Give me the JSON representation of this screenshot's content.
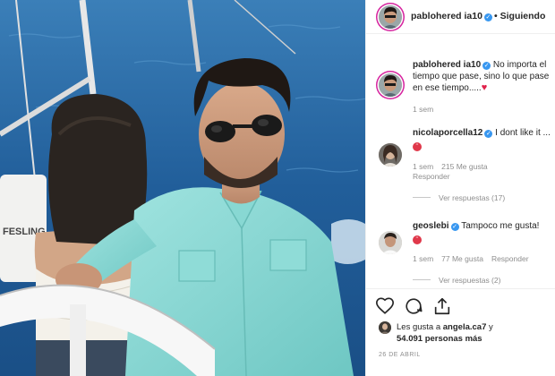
{
  "post": {
    "username": "pablohered ia10",
    "follow_label": "Siguiendo"
  },
  "caption": {
    "username": "pablohered ia10",
    "text": "No importa el tiempo que pase, sino lo que pase en ese tiempo.....",
    "time": "1 sem"
  },
  "comments": [
    {
      "username": "nicolaporcella12",
      "text": "I dont like it ...",
      "time": "1 sem",
      "likes": "215 Me gusta",
      "reply_label": "Responder",
      "view_replies": "Ver respuestas (17)"
    },
    {
      "username": "geoslebi",
      "text": "Tampoco me gusta!",
      "time": "1 sem",
      "likes": "77 Me gusta",
      "reply_label": "Responder",
      "view_replies": "Ver respuestas (2)"
    }
  ],
  "likes_line": {
    "prefix": "Les gusta a",
    "user": "angela.ca7",
    "conj": "y",
    "count": "54.091 personas más"
  },
  "date": "26 DE ABRIL",
  "colors": {
    "verified": "#3897f0",
    "story_ring": "#d6249f",
    "muted_text": "#8e8e8e",
    "sea": "#2d6fa8",
    "shirt": "#7ed3cf"
  },
  "icons": [
    "verified-icon",
    "heart-icon",
    "comment-icon",
    "share-icon",
    "angry-emoji-icon",
    "red-heart-icon"
  ]
}
